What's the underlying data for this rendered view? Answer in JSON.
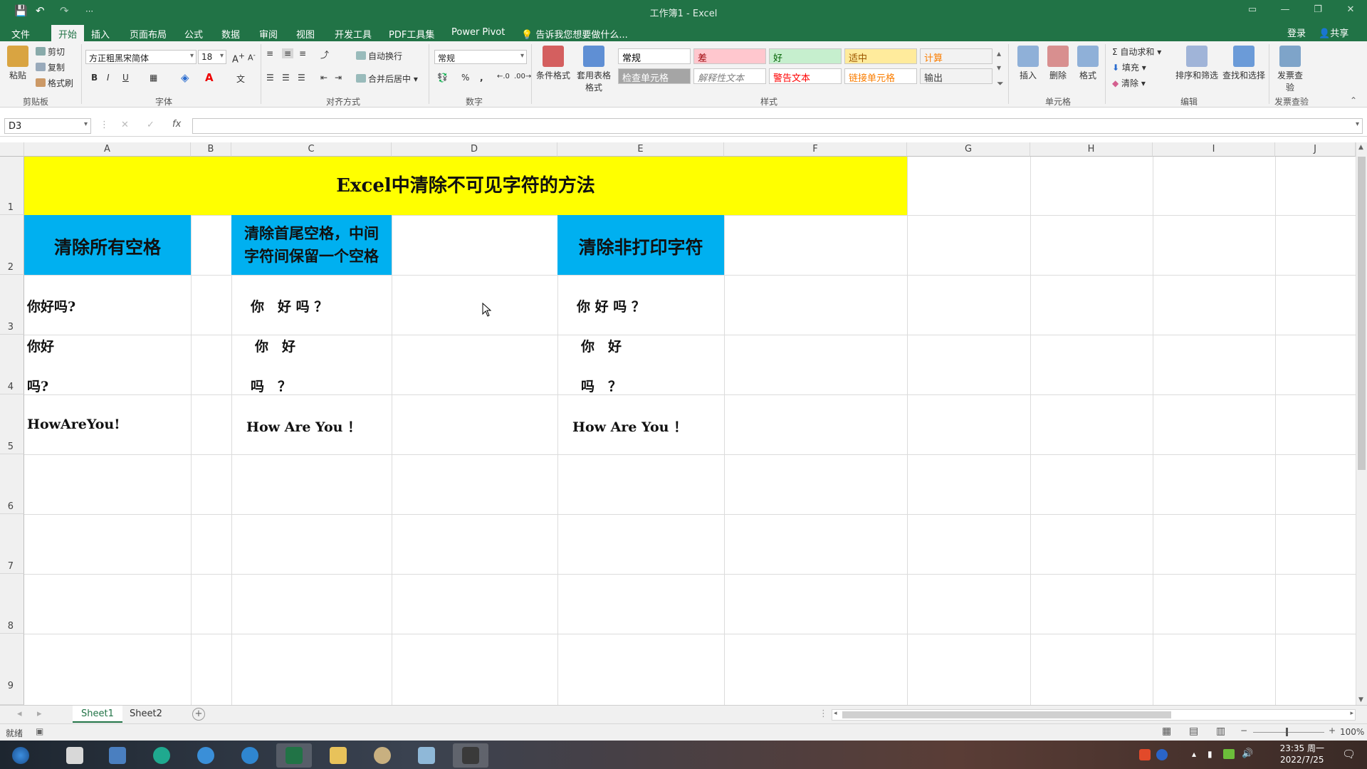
{
  "window": {
    "title": "工作簿1 - Excel"
  },
  "quick_access": {
    "save": "💾",
    "undo": "↶",
    "redo": "↷",
    "customize": "⋯"
  },
  "tabs": [
    "文件",
    "开始",
    "插入",
    "页面布局",
    "公式",
    "数据",
    "审阅",
    "视图",
    "开发工具",
    "PDF工具集",
    "Power Pivot"
  ],
  "active_tab": "开始",
  "tell_me": "告诉我您想要做什么...",
  "account": {
    "signin": "登录",
    "share": "共享"
  },
  "ribbon": {
    "clipboard": {
      "paste": "粘贴",
      "cut": "剪切",
      "copy": "复制",
      "format_painter": "格式刷",
      "label": "剪贴板"
    },
    "font": {
      "name": "方正粗黑宋简体",
      "size": "18",
      "bold": "B",
      "italic": "I",
      "underline": "U",
      "label": "字体"
    },
    "alignment": {
      "wrap": "自动换行",
      "merge": "合并后居中",
      "label": "对齐方式"
    },
    "number": {
      "format": "常规",
      "percent": "%",
      "comma": ",",
      "label": "数字"
    },
    "styles": {
      "conditional": "条件格式",
      "table": "套用表格格式",
      "cells": [
        {
          "text": "常规",
          "bg": "#ffffff",
          "color": "#000000"
        },
        {
          "text": "差",
          "bg": "#ffc7ce",
          "color": "#9c0006"
        },
        {
          "text": "好",
          "bg": "#c6efce",
          "color": "#006100"
        },
        {
          "text": "适中",
          "bg": "#ffeb9c",
          "color": "#9c5700"
        },
        {
          "text": "计算",
          "bg": "#f2f2f2",
          "color": "#fa7d00"
        },
        {
          "text": "检查单元格",
          "bg": "#a5a5a5",
          "color": "#ffffff"
        },
        {
          "text": "解释性文本",
          "bg": "#ffffff",
          "color": "#7f7f7f"
        },
        {
          "text": "警告文本",
          "bg": "#ffffff",
          "color": "#ff0000"
        },
        {
          "text": "链接单元格",
          "bg": "#ffffff",
          "color": "#fa7d00"
        },
        {
          "text": "输出",
          "bg": "#f2f2f2",
          "color": "#3f3f3f"
        }
      ],
      "label": "样式"
    },
    "cells_group": {
      "insert": "插入",
      "delete": "删除",
      "format": "格式",
      "label": "单元格"
    },
    "editing": {
      "autosum": "自动求和",
      "fill": "填充",
      "clear": "清除",
      "sort": "排序和筛选",
      "find": "查找和选择",
      "label": "编辑"
    },
    "invoice": {
      "check": "发票查验",
      "label": "发票查验"
    }
  },
  "formula_bar": {
    "name_box": "D3",
    "fx": "fx",
    "content": ""
  },
  "columns": [
    "A",
    "B",
    "C",
    "D",
    "E",
    "F",
    "G",
    "H",
    "I",
    "J"
  ],
  "rows": [
    "1",
    "2",
    "3",
    "4",
    "5",
    "6",
    "7",
    "8",
    "9"
  ],
  "sheet": {
    "title": "Excel中清除不可见字符的方法",
    "headers": {
      "a": "清除所有空格",
      "c_line1": "清除首尾空格，中间",
      "c_line2": "字符间保留一个空格",
      "e": "清除非打印字符"
    },
    "col_a": {
      "r3": "你好吗?",
      "r4_1": "你好",
      "r4_2": "吗?",
      "r5": "HowAreYou!"
    },
    "col_c": {
      "r3": "你　好 吗 ？",
      "r4_1": "你　好",
      "r4_2": "吗　？",
      "r5": "How Are You ！"
    },
    "col_e": {
      "r3": "你 好 吗 ？",
      "r4_1": "你　好",
      "r4_2": "吗　？",
      "r5": "How Are You ！"
    }
  },
  "sheet_tabs": [
    "Sheet1",
    "Sheet2"
  ],
  "active_sheet": "Sheet1",
  "status": {
    "ready": "就绪",
    "zoom": "100%"
  },
  "clock": {
    "time": "23:35 周一",
    "date": "2022/7/25"
  },
  "colors": {
    "excel_green": "#217346",
    "title_fill": "#ffff00",
    "header_fill": "#00b0f0"
  }
}
